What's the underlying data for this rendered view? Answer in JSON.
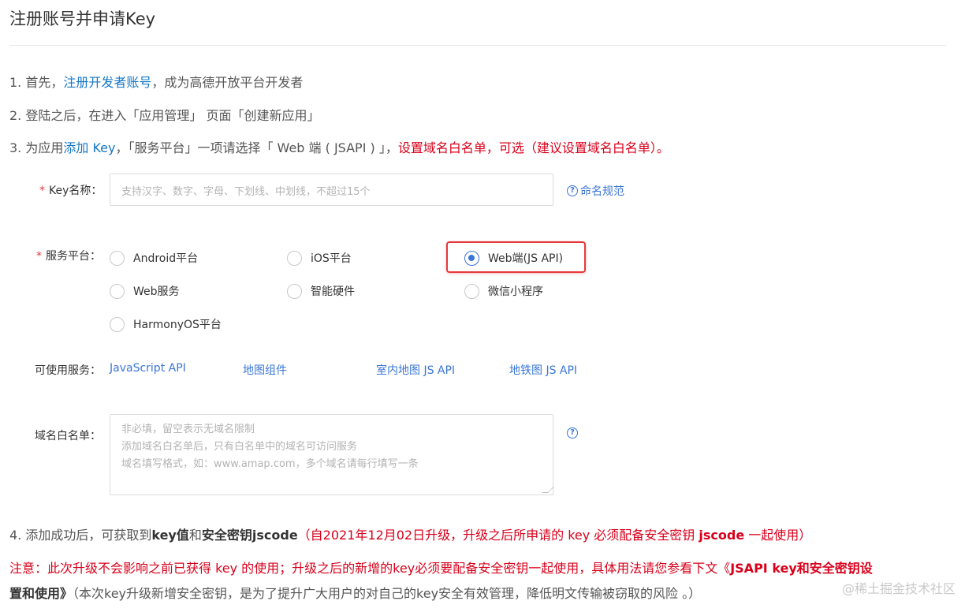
{
  "title": "注册账号并申请Key",
  "steps": {
    "s1_prefix": "1. 首先，",
    "s1_link": "注册开发者账号",
    "s1_suffix": "，成为高德开放平台开发者",
    "s2": "2. 登陆之后，在进入「应用管理」 页面「创建新应用」",
    "s3_prefix": "3. 为应用",
    "s3_link": "添加 Key",
    "s3_middle": "，「服务平台」一项请选择「 Web 端 ( JSAPI ) 」，",
    "s3_red": "设置域名白名单，可选（建议设置域名白名单）。",
    "s4_prefix": "4. 添加成功后，可获取到",
    "s4_bold1": "key值",
    "s4_and": "和",
    "s4_bold2": "安全密钥jscode",
    "s4_red_pre": "（自2021年12月02日升级，升级之后所申请的 key 必须配备安全密钥 ",
    "s4_red_bold": "jscode",
    "s4_red_post": " 一起使用）"
  },
  "form": {
    "req_mark": "*",
    "key_label": "Key名称：",
    "key_placeholder": "支持汉字、数字、字母、下划线、中划线，不超过15个",
    "naming_help": "命名规范",
    "help_glyph": "?",
    "platform_label": "服务平台：",
    "platforms": [
      {
        "label": "Android平台",
        "checked": false
      },
      {
        "label": "iOS平台",
        "checked": false
      },
      {
        "label": "Web端(JS API)",
        "checked": true
      },
      {
        "label": "Web服务",
        "checked": false
      },
      {
        "label": "智能硬件",
        "checked": false
      },
      {
        "label": "微信小程序",
        "checked": false
      },
      {
        "label": "HarmonyOS平台",
        "checked": false
      }
    ],
    "services_label": "可使用服务：",
    "services": [
      "JavaScript API",
      "地图组件",
      "室内地图 JS API",
      "地铁图 JS API"
    ],
    "domain_label": "域名白名单：",
    "domain_placeholder_lines": [
      "非必填，留空表示无域名限制",
      "添加域名白名单后，只有白名单中的域名可访问服务",
      "域名填写格式，如：www.amap.com，多个域名请每行填写一条"
    ]
  },
  "notes": {
    "n1_red": "注意：此次升级不会影响之前已获得 key 的使用；升级之后的新增的key必须要配备安全密钥一起使用，具体用法请您参看下文《",
    "n1_bold": "JSAPI key和安全密钥设",
    "n2_bold": "置和使用》",
    "n2_rest": "（本次key升级新增安全密钥，是为了提升广大用户的对自己的key安全有效管理，降低明文传输被窃取的风险 。）"
  },
  "watermark": "@稀土掘金技术社区",
  "colors": {
    "link": "#1677c7",
    "accent": "#3a76d6",
    "red": "#d9001b",
    "highlight": "#e4393c"
  }
}
